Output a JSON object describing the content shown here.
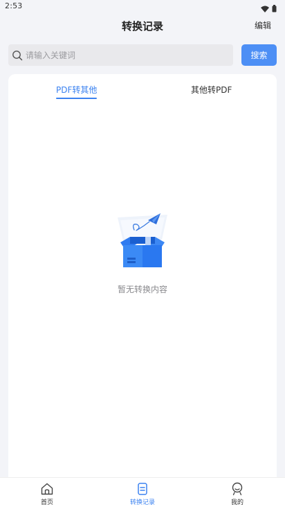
{
  "status_bar": {
    "time": "2:53"
  },
  "header": {
    "title": "转换记录",
    "edit_label": "编辑"
  },
  "search": {
    "placeholder": "请输入关键词",
    "value": "",
    "button_label": "搜索"
  },
  "tabs": [
    {
      "label": "PDF转其他",
      "active": true
    },
    {
      "label": "其他转PDF",
      "active": false
    }
  ],
  "empty_state": {
    "text": "暂无转换内容",
    "icon": "open-box-with-paper-plane-icon"
  },
  "bottom_nav": {
    "items": [
      {
        "label": "首页",
        "icon": "home-icon",
        "active": false
      },
      {
        "label": "转换记录",
        "icon": "document-icon",
        "active": true
      },
      {
        "label": "我的",
        "icon": "profile-icon",
        "active": false
      }
    ]
  },
  "colors": {
    "accent": "#3b82f0",
    "search_button": "#4d8ff5",
    "background": "#f3f4f8",
    "card": "#ffffff"
  }
}
